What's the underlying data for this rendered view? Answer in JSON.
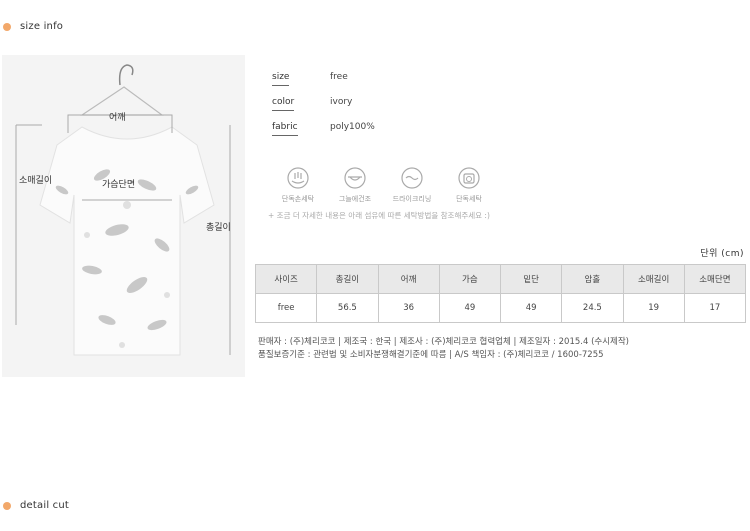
{
  "size_info": {
    "title": "size info"
  },
  "detail_cut": {
    "title": "detail cut"
  },
  "measurements": {
    "shoulder": "어깨",
    "sleeve_length": "소매길이",
    "chest": "가슴단면",
    "total_length": "총길이"
  },
  "specs": [
    {
      "key": "size",
      "value": "free"
    },
    {
      "key": "color",
      "value": "ivory"
    },
    {
      "key": "fabric",
      "value": "poly100%"
    }
  ],
  "care": {
    "items": [
      {
        "label": "단독손세탁",
        "icon": "hand-wash-icon"
      },
      {
        "label": "그늘에건조",
        "icon": "shade-dry-icon"
      },
      {
        "label": "드라이크리닝",
        "icon": "dry-clean-icon"
      },
      {
        "label": "단독세탁",
        "icon": "separate-wash-icon"
      }
    ],
    "note": "+ 조금 더 자세한 내용은 아래 섬유에 따른 세탁방법을 참조해주세요 :)"
  },
  "unit": "단위 (cm)",
  "size_table": {
    "headers": [
      "사이즈",
      "총길이",
      "어깨",
      "가슴",
      "밑단",
      "암홀",
      "소매길이",
      "소매단면"
    ],
    "row": [
      "free",
      "56.5",
      "36",
      "49",
      "49",
      "24.5",
      "19",
      "17"
    ]
  },
  "legal": {
    "line1": "판매자 : (주)체리코코 | 제조국 : 한국  | 제조사 : (주)체리코코 협력업체 | 제조일자 : 2015.4 (수시제작)",
    "line2": "품질보증기준 : 관련법 및 소비자분쟁해결기준에 따름 | A/S 책임자 : (주)체리코코 / 1600-7255"
  },
  "colors": {
    "accent_dot": "#f2a86a",
    "table_header_bg": "#e9e9e9",
    "photo_bg": "#f4f4f4"
  }
}
